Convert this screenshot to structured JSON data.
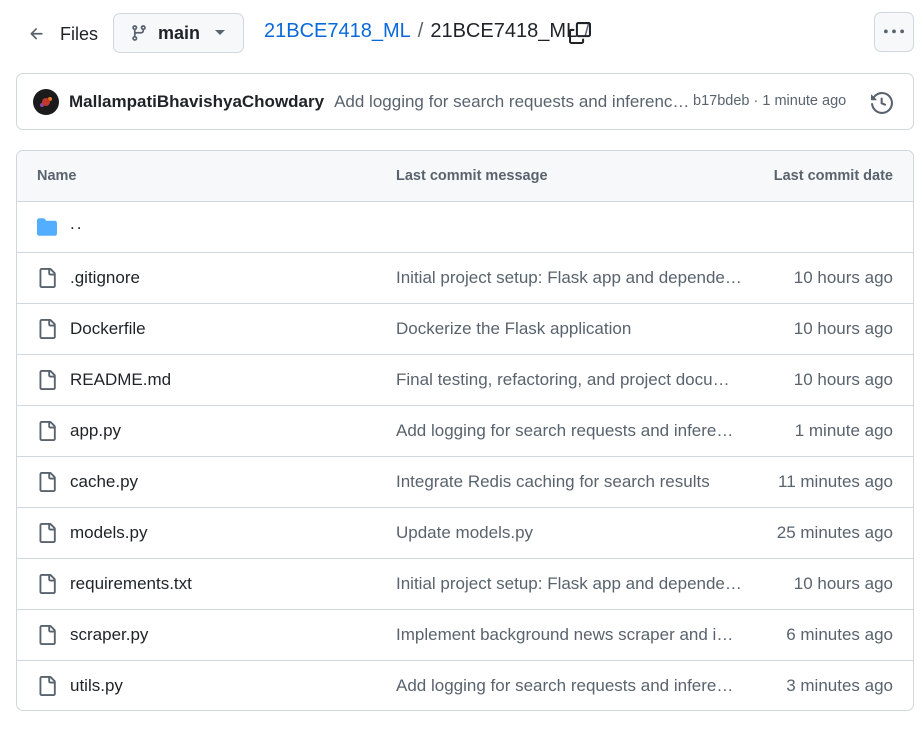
{
  "header": {
    "files_label": "Files",
    "branch": "main",
    "breadcrumb": {
      "repo_link": "21BCE7418_ML",
      "separator": "/",
      "current": "21BCE7418_ML",
      "trailing_separator": "/"
    }
  },
  "commit": {
    "author": "MallampatiBhavishyaChowdary",
    "message": "Add logging for search requests and inference time",
    "sha": "b17bdeb",
    "dot": "·",
    "time": "1 minute ago"
  },
  "table": {
    "headers": {
      "name": "Name",
      "message": "Last commit message",
      "date": "Last commit date"
    },
    "parent_dir": "..",
    "rows": [
      {
        "name": ".gitignore",
        "message": "Initial project setup: Flask app and dependencies",
        "date": "10 hours ago",
        "icon": "file-icon"
      },
      {
        "name": "Dockerfile",
        "message": "Dockerize the Flask application",
        "date": "10 hours ago",
        "icon": "file-icon"
      },
      {
        "name": "README.md",
        "message": "Final testing, refactoring, and project documentation",
        "date": "10 hours ago",
        "icon": "file-icon"
      },
      {
        "name": "app.py",
        "message": "Add logging for search requests and inference time",
        "date": "1 minute ago",
        "icon": "file-icon"
      },
      {
        "name": "cache.py",
        "message": "Integrate Redis caching for search results",
        "date": "11 minutes ago",
        "icon": "file-icon"
      },
      {
        "name": "models.py",
        "message": "Update models.py",
        "date": "25 minutes ago",
        "icon": "file-icon"
      },
      {
        "name": "requirements.txt",
        "message": "Initial project setup: Flask app and dependencies",
        "date": "10 hours ago",
        "icon": "file-icon"
      },
      {
        "name": "scraper.py",
        "message": "Implement background news scraper and indexing",
        "date": "6 minutes ago",
        "icon": "file-icon"
      },
      {
        "name": "utils.py",
        "message": "Add logging for search requests and inference time",
        "date": "3 minutes ago",
        "icon": "file-icon"
      }
    ]
  },
  "colors": {
    "link": "#0969da",
    "muted": "#59636e",
    "border": "#d0d7de",
    "folder": "#54aeff",
    "header_bg": "#f6f8fa"
  }
}
